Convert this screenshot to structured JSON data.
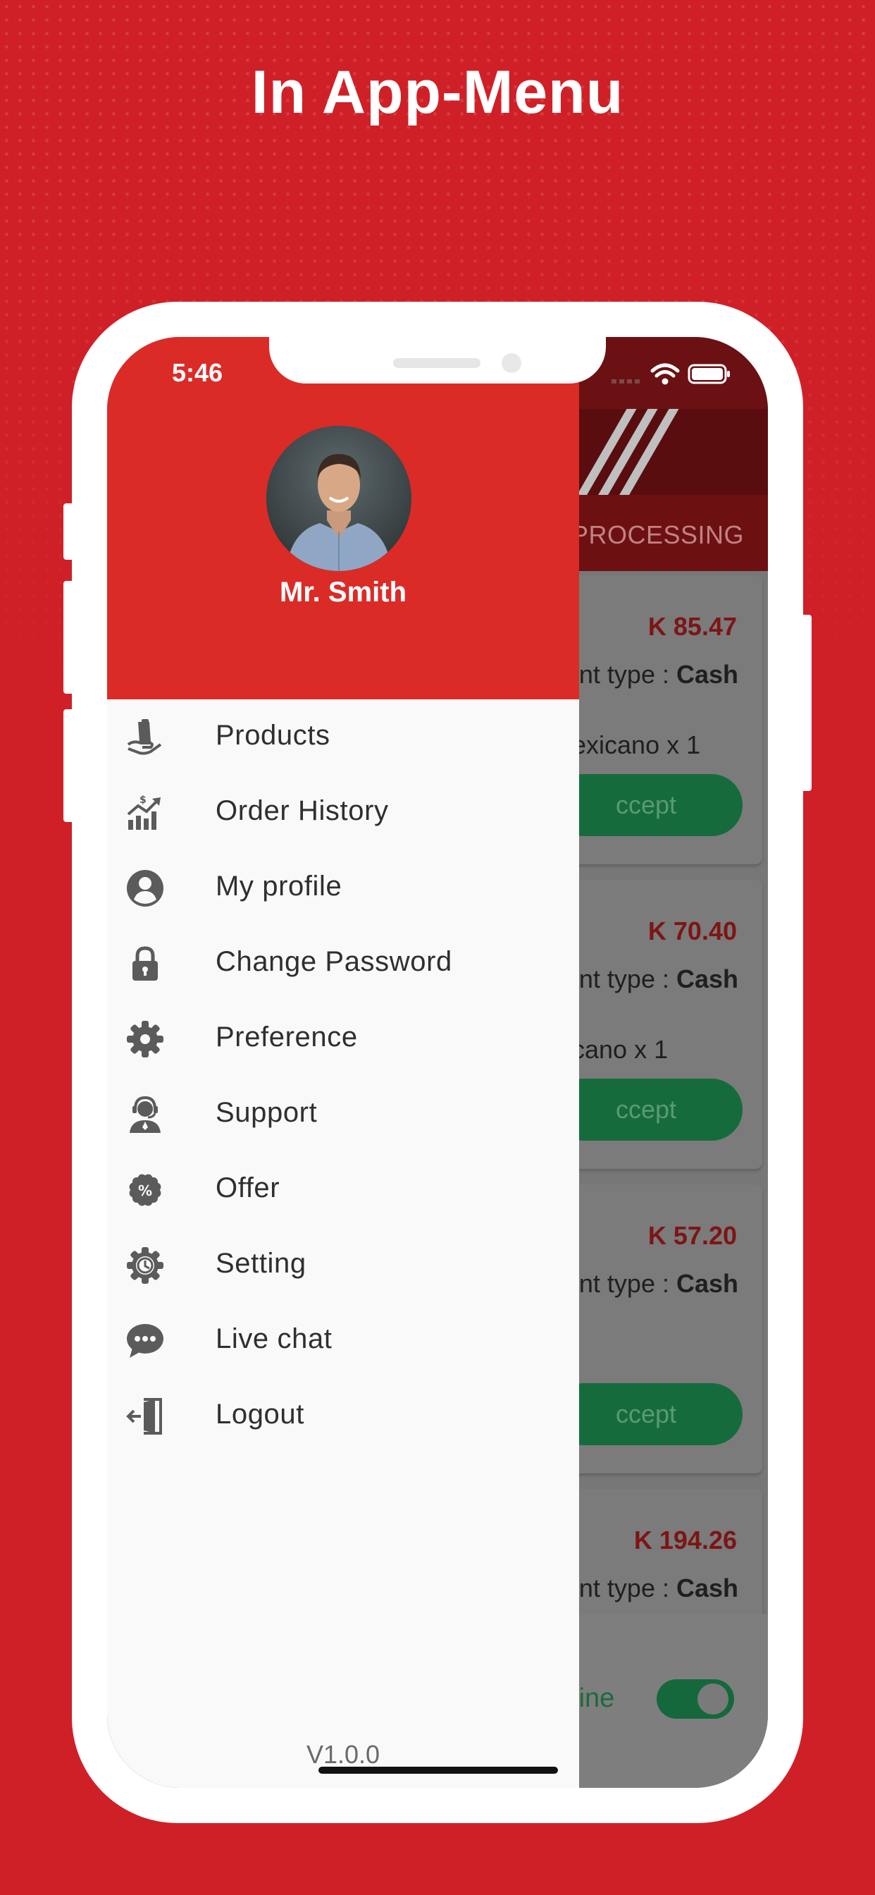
{
  "headline": "In App-Menu",
  "status_bar": {
    "time": "5:46"
  },
  "drawer": {
    "user_name": "Mr. Smith",
    "menu_items": [
      {
        "label": "Products",
        "icon": "hand-bag-icon"
      },
      {
        "label": "Order History",
        "icon": "chart-growth-icon"
      },
      {
        "label": "My profile",
        "icon": "user-circle-icon"
      },
      {
        "label": "Change Password",
        "icon": "lock-icon"
      },
      {
        "label": "Preference",
        "icon": "gear-icon"
      },
      {
        "label": "Support",
        "icon": "support-agent-icon"
      },
      {
        "label": "Offer",
        "icon": "percent-badge-icon"
      },
      {
        "label": "Setting",
        "icon": "gear-clock-icon"
      },
      {
        "label": "Live chat",
        "icon": "chat-bubble-icon"
      },
      {
        "label": "Logout",
        "icon": "logout-door-icon"
      }
    ],
    "version": "V1.0.0"
  },
  "background_app": {
    "tab_label": "PROCESSING",
    "orders": [
      {
        "price": "K 85.47",
        "payment_prefix": "nt type : ",
        "payment_method": "Cash",
        "item": "exicano x 1",
        "button": "ccept"
      },
      {
        "price": "K 70.40",
        "payment_prefix": "nt type : ",
        "payment_method": "Cash",
        "item": "cano x 1",
        "button": "ccept"
      },
      {
        "price": "K 57.20",
        "payment_prefix": "nt type : ",
        "payment_method": "Cash",
        "item": "",
        "button": "ccept"
      },
      {
        "price": "K 194.26",
        "payment_prefix": "nt type : ",
        "payment_method": "Cash",
        "item": "",
        "button": ""
      }
    ],
    "online_label": "nline",
    "online_toggle_on": true
  },
  "colors": {
    "brand_red": "#cf2027",
    "drawer_header_red": "#db2b27",
    "accept_green": "#166b3c",
    "drawer_bg": "#f9f9f9",
    "icon_gray": "#5b5b5b"
  }
}
